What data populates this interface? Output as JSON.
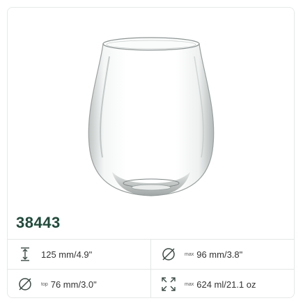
{
  "product": {
    "sku": "38443"
  },
  "specs": {
    "height": {
      "icon": "height-icon",
      "value": "125 mm/4.9\""
    },
    "max_diameter": {
      "icon": "diameter-icon",
      "prefix": "max",
      "value": "96 mm/3.8\""
    },
    "top_diameter": {
      "icon": "diameter-icon",
      "prefix": "top",
      "value": "76 mm/3.0\""
    },
    "capacity": {
      "icon": "capacity-expand-icon",
      "prefix": "max",
      "value": "624 ml/21.1 oz"
    }
  },
  "colors": {
    "sku": "#1f4a3a",
    "icon": "#3b4a45",
    "border": "#e3e7e5"
  }
}
